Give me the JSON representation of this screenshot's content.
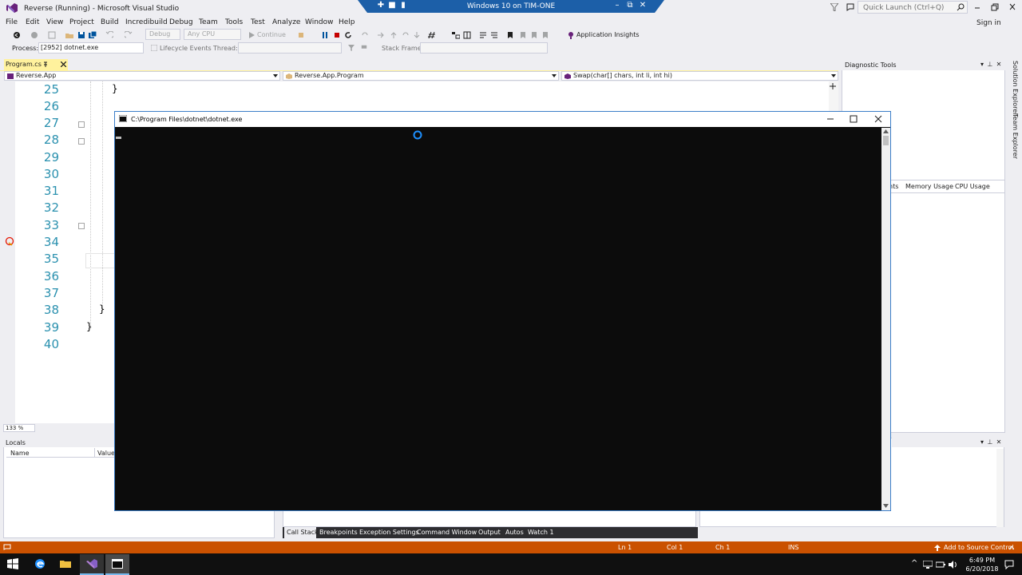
{
  "window": {
    "title": "Reverse (Running) - Microsoft Visual Studio",
    "remote_session": "Windows 10 on TIM-ONE",
    "quick_launch_placeholder": "Quick Launch (Ctrl+Q)",
    "sign_in": "Sign in"
  },
  "menu": [
    "File",
    "Edit",
    "View",
    "Project",
    "Build",
    "Incredibuild",
    "Debug",
    "Team",
    "Tools",
    "Test",
    "Analyze",
    "Window",
    "Help"
  ],
  "toolbar": {
    "config": "Debug",
    "platform": "Any CPU",
    "continue": "Continue",
    "app_insights": "Application Insights"
  },
  "debug_toolbar": {
    "process_label": "Process:",
    "process_value": "[2952] dotnet.exe",
    "lifecycle": "Lifecycle Events",
    "thread_label": "Thread:",
    "stack_frame_label": "Stack Frame:"
  },
  "editor": {
    "tab": "Program.cs",
    "nav_project": "Reverse.App",
    "nav_class": "Reverse.App.Program",
    "nav_member": "Swap(char[] chars, int li, int hi)",
    "line_numbers": [
      "25",
      "26",
      "27",
      "28",
      "29",
      "30",
      "31",
      "32",
      "33",
      "34",
      "35",
      "36",
      "37",
      "38",
      "39",
      "40"
    ],
    "zoom": "133 %"
  },
  "diagnostic_tools": {
    "title": "Diagnostic Tools",
    "tabs": [
      "nts",
      "Memory Usage",
      "CPU Usage"
    ]
  },
  "side_tabs": [
    "Solution Explorer",
    "Team Explorer"
  ],
  "locals": {
    "title": "Locals",
    "columns": [
      "Name",
      "Value"
    ]
  },
  "bottom_tabs": [
    "Call Stack",
    "Breakpoints",
    "Exception Settings",
    "Command Window",
    "Output",
    "Autos",
    "Watch 1"
  ],
  "status": {
    "ln": "Ln 1",
    "col": "Col 1",
    "ch": "Ch 1",
    "ins": "INS",
    "source_control": "Add to Source Control"
  },
  "console": {
    "title": "C:\\Program Files\\dotnet\\dotnet.exe"
  },
  "taskbar": {
    "time": "6:49 PM",
    "date": "6/20/2018"
  },
  "colors": {
    "status_bar": "#ca5100",
    "vs_accent": "#68217a",
    "rdp_bar": "#1c5fa8",
    "tab_active": "#fff29d"
  }
}
